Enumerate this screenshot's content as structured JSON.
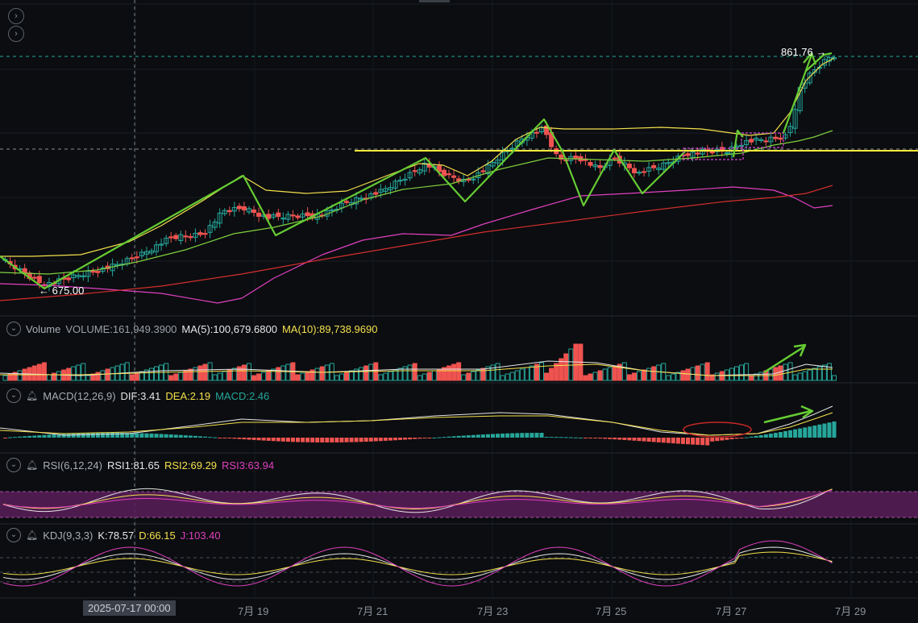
{
  "colors": {
    "up": "#26a69a",
    "down": "#ef5350",
    "ma_yellow": "#f4e04d",
    "ma_green": "#7fcf3f",
    "ma_pink": "#e040c0",
    "ma_red": "#d32f2f",
    "annotation": "#66cc33",
    "rsi_band": "#5a1e5a"
  },
  "buttons": {
    "expand_1": "chevron-right-icon",
    "expand_2": "chevron-right-icon"
  },
  "price_labels": {
    "high": "861.76 →",
    "low": "← 675.00"
  },
  "volume": {
    "title": "Volume",
    "value": "VOLUME:161,949.3900",
    "ma5": "MA(5):100,679.6800",
    "ma10": "MA(10):89,738.9690"
  },
  "macd": {
    "title": "MACD(12,26,9)",
    "dif": "DIF:3.41",
    "dea": "DEA:2.19",
    "macd": "MACD:2.46"
  },
  "rsi": {
    "title": "RSI(6,12,24)",
    "rsi1": "RSI1:81.65",
    "rsi2": "RSI2:69.29",
    "rsi3": "RSI3:63.94"
  },
  "kdj": {
    "title": "KDJ(9,3,3)",
    "k": "K:78.57",
    "d": "D:66.15",
    "j": "J:103.40"
  },
  "x_axis": {
    "highlight": "2025-07-17 00:00",
    "labels": [
      "7月 19",
      "7月 21",
      "7月 23",
      "7月 25",
      "7月 27",
      "7月 29"
    ]
  },
  "chart_data": {
    "type": "candlestick",
    "annotations": [
      "861.76 →",
      "← 675.00"
    ],
    "y_levels": {
      "high": 861.76,
      "low": 675.0
    }
  }
}
